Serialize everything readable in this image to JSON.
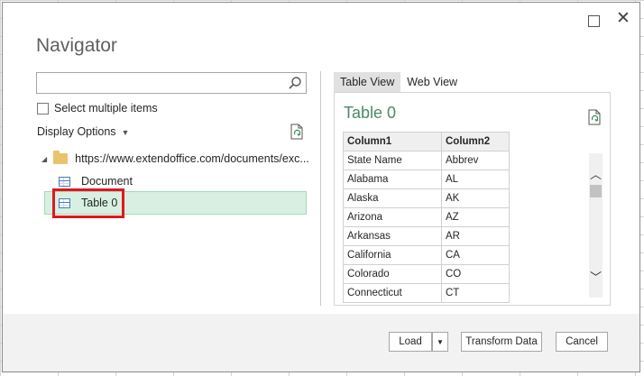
{
  "dialog": {
    "title": "Navigator",
    "window_controls": {
      "maximize": "☐",
      "close": "✕"
    }
  },
  "left_panel": {
    "search": {
      "value": "",
      "placeholder": ""
    },
    "select_multiple_label": "Select multiple items",
    "display_options_label": "Display Options",
    "tree": {
      "root_url": "https://www.extendoffice.com/documents/exc...",
      "items": [
        {
          "label": "Document",
          "icon": "table-icon"
        },
        {
          "label": "Table 0",
          "icon": "table-icon",
          "selected": true
        }
      ]
    }
  },
  "right_panel": {
    "tabs": [
      {
        "label": "Table View",
        "active": true
      },
      {
        "label": "Web View",
        "active": false
      }
    ],
    "preview_title": "Table 0",
    "columns": [
      "Column1",
      "Column2"
    ],
    "rows": [
      [
        "State Name",
        "Abbrev"
      ],
      [
        "Alabama",
        "AL"
      ],
      [
        "Alaska",
        "AK"
      ],
      [
        "Arizona",
        "AZ"
      ],
      [
        "Arkansas",
        "AR"
      ],
      [
        "California",
        "CA"
      ],
      [
        "Colorado",
        "CO"
      ],
      [
        "Connecticut",
        "CT"
      ]
    ]
  },
  "footer": {
    "load_label": "Load",
    "transform_label": "Transform Data",
    "cancel_label": "Cancel"
  },
  "colors": {
    "accent_green": "#4a8a68",
    "selection_bg": "#d7f0e1",
    "highlight_red": "#e1171e"
  }
}
